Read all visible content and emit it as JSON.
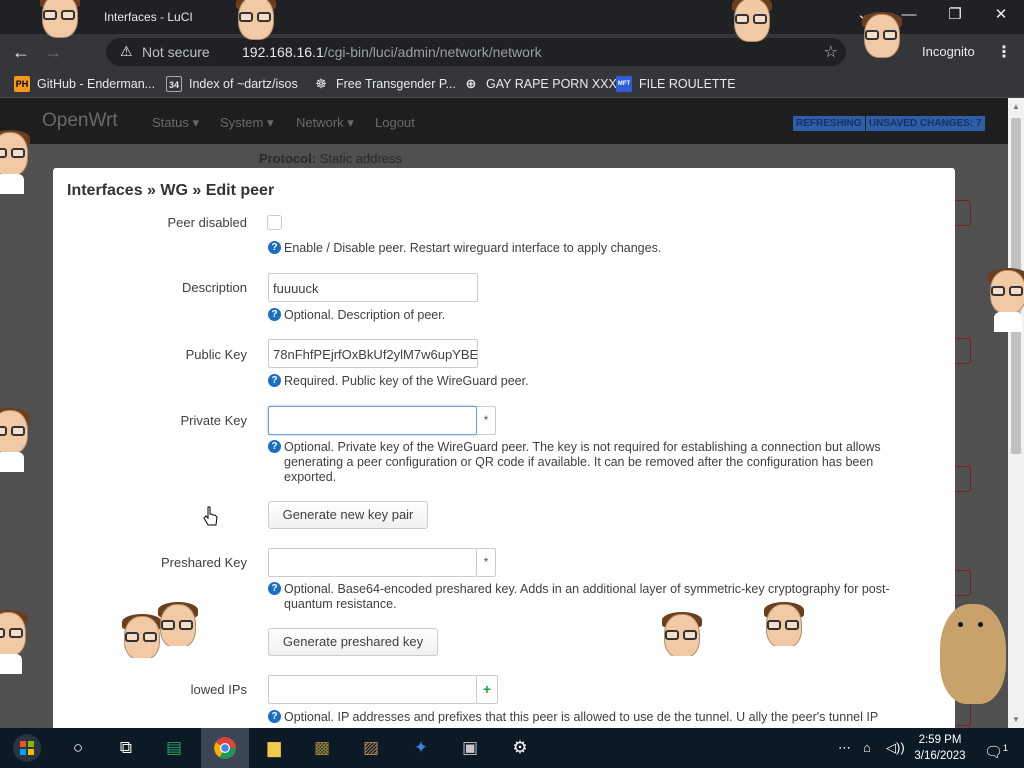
{
  "browser": {
    "tab_title": "Interfaces - LuCI",
    "security": "Not secure",
    "url_host": "192.168.16.1",
    "url_path": "/cgi-bin/luci/admin/network/network",
    "mode": "Incognito",
    "bookmarks": [
      {
        "icon": "PH",
        "label": "GitHub - Enderman..."
      },
      {
        "icon": "34",
        "label": "Index of ~dartz/isos"
      },
      {
        "icon": "",
        "label": "Free Transgender P..."
      },
      {
        "icon": "",
        "label": "GAY RAPE PORN XXX"
      },
      {
        "icon": "MFT",
        "label": "FILE ROULETTE"
      }
    ]
  },
  "luci": {
    "brand": "OpenWrt",
    "nav": [
      "Status",
      "System",
      "Network",
      "Logout"
    ],
    "badges": {
      "refreshing": "REFRESHING",
      "unsaved": "UNSAVED CHANGES: 7"
    },
    "bg_protocol_label": "Protocol:",
    "bg_protocol_value": "Static address"
  },
  "modal": {
    "title": "Interfaces » WG » Edit peer",
    "fields": {
      "peer_disabled": {
        "label": "Peer disabled",
        "help": "Enable / Disable peer. Restart wireguard interface to apply changes."
      },
      "description": {
        "label": "Description",
        "value": "fuuuuck",
        "help": "Optional. Description of peer."
      },
      "public_key": {
        "label": "Public Key",
        "value": "78nFhfPEjrfOxBkUf2ylM7w6upYBE",
        "help": "Required. Public key of the WireGuard peer."
      },
      "private_key": {
        "label": "Private Key",
        "value": "",
        "addon": "*",
        "help": "Optional. Private key of the WireGuard peer. The key is not required for establishing a connection but allows generating a peer configuration or QR code if available. It can be removed after the configuration has been exported."
      },
      "generate_keypair": {
        "label": "Generate new key pair"
      },
      "preshared_key": {
        "label": "Preshared Key",
        "value": "",
        "addon": "*",
        "help": "Optional. Base64-encoded preshared key. Adds in an additional layer of symmetric-key cryptography for post-quantum resistance."
      },
      "generate_psk": {
        "label": "Generate preshared key"
      },
      "allowed_ips": {
        "label": "lowed IPs",
        "value": "",
        "addon": "+",
        "help": "Optional. IP addresses and prefixes that this peer is allowed to use  de the tunnel. U  ally the peer's tunnel IP"
      }
    }
  },
  "taskbar": {
    "time": "2:59 PM",
    "date": "3/16/2023",
    "notification_count": "1"
  },
  "colors": {
    "help_icon": "#1b6ec2",
    "browser_bg": "#202124",
    "toolbar_bg": "#35363a",
    "overlay_bg": "#505050",
    "taskbar_bg": "#0c1a26"
  }
}
